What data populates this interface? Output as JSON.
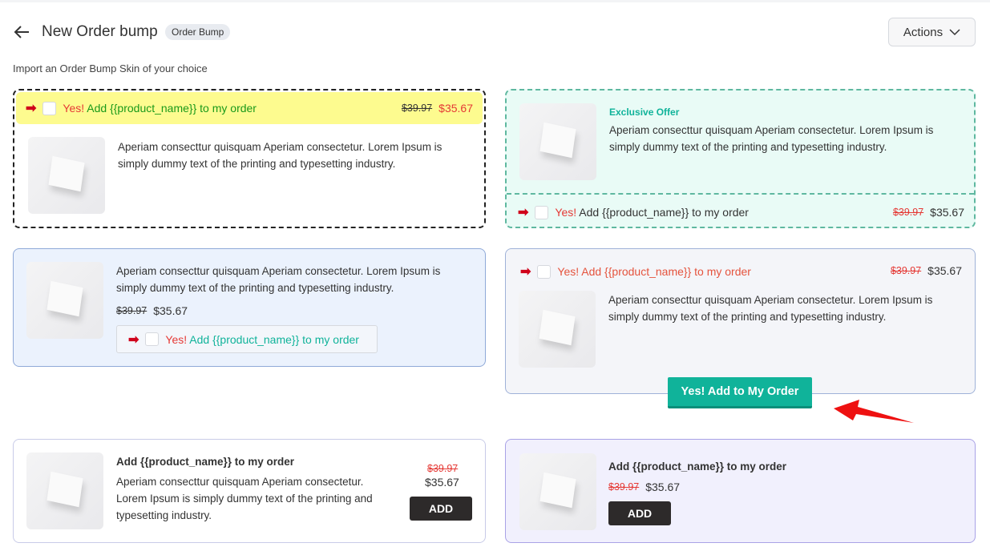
{
  "header": {
    "title": "New Order bump",
    "badge": "Order Bump",
    "actions_label": "Actions",
    "subtitle": "Import an Order Bump Skin of your choice"
  },
  "colors": {
    "green_accent": "#10b39a",
    "red": "#e53935",
    "arrow_red": "#d0021b",
    "yellow": "#fdfb8f"
  },
  "skins": [
    {
      "yes": "Yes!",
      "add_text": "Add {{product_name}} to my order",
      "old_price": "$39.97",
      "price": "$35.67",
      "description": "Aperiam consecttur quisquam Aperiam consectetur. Lorem Ipsum is simply dummy text of the printing and typesetting industry."
    },
    {
      "label": "Exclusive Offer",
      "yes": "Yes!",
      "add_text": "Add {{product_name}} to my order",
      "old_price": "$39.97",
      "price": "$35.67",
      "description": "Aperiam consecttur quisquam Aperiam consectetur. Lorem Ipsum is simply dummy text of the printing and typesetting industry."
    },
    {
      "yes": "Yes!",
      "add_text": "Add {{product_name}} to my order",
      "old_price": "$39.97",
      "price": "$35.67",
      "description": "Aperiam consecttur quisquam Aperiam consectetur. Lorem Ipsum is simply dummy text of the printing and typesetting industry."
    },
    {
      "cta": "Yes! Add {{product_name}} to my order",
      "old_price": "$39.97",
      "price": "$35.67",
      "description": "Aperiam consecttur quisquam Aperiam consectetur. Lorem Ipsum is simply dummy text of the printing and typesetting industry.",
      "button": "Yes! Add to My Order"
    },
    {
      "title": "Add {{product_name}} to my order",
      "old_price": "$39.97",
      "price": "$35.67",
      "description": "Aperiam consecttur quisquam Aperiam consectetur. Lorem Ipsum is simply dummy text of the printing and typesetting industry.",
      "button": "ADD"
    },
    {
      "title": "Add {{product_name}} to my order",
      "old_price": "$39.97",
      "price": "$35.67",
      "button": "ADD"
    }
  ]
}
